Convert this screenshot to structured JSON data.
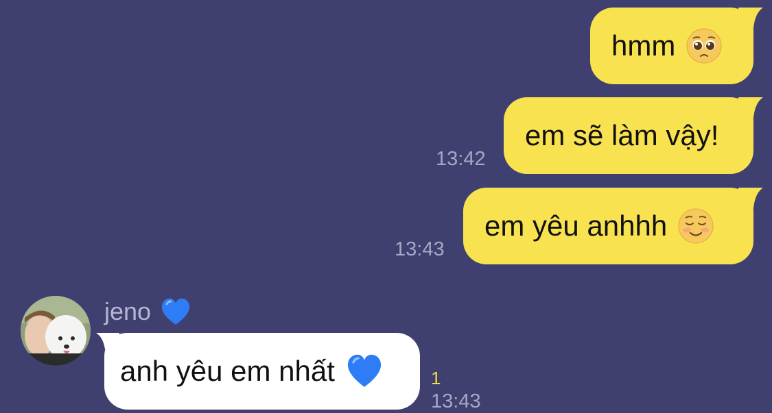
{
  "messages": [
    {
      "direction": "out",
      "text": "hmm",
      "emoji": "pleading-face-icon",
      "time": ""
    },
    {
      "direction": "out",
      "text": "em sẽ làm vậy!",
      "emoji": "",
      "time": "13:42"
    },
    {
      "direction": "out",
      "text": "em yêu anhhh",
      "emoji": "smiling-face-icon",
      "time": "13:43"
    },
    {
      "direction": "in",
      "sender": "jeno",
      "sender_emoji": "blue-heart-icon",
      "text": "anh yêu em nhất",
      "emoji": "blue-heart-icon",
      "unread_count": "1",
      "time": "13:43"
    }
  ],
  "colors": {
    "background": "#404070",
    "outgoing_bubble": "#f9e250",
    "incoming_bubble": "#ffffff",
    "timestamp": "#a6a6c6",
    "unread": "#f4d94a"
  }
}
